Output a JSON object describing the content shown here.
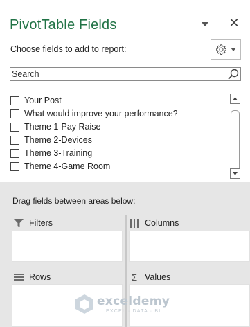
{
  "header": {
    "title": "PivotTable Fields",
    "subtitle": "Choose fields to add to report:"
  },
  "search": {
    "placeholder": "Search"
  },
  "fields": [
    {
      "label": "Your Post",
      "checked": false
    },
    {
      "label": "What would improve your performance?",
      "checked": false
    },
    {
      "label": "Theme 1-Pay Raise",
      "checked": false
    },
    {
      "label": "Theme 2-Devices",
      "checked": false
    },
    {
      "label": "Theme 3-Training",
      "checked": false
    },
    {
      "label": "Theme 4-Game Room",
      "checked": false
    }
  ],
  "areas": {
    "instruction": "Drag fields between areas below:",
    "filters": "Filters",
    "columns": "Columns",
    "rows": "Rows",
    "values": "Values"
  },
  "watermark": {
    "name": "exceldemy",
    "tagline": "EXCEL · DATA · BI"
  },
  "icons": {
    "close": "close-icon",
    "gear": "gear-icon",
    "search": "search-icon",
    "filter": "filter-icon",
    "columns": "columns-icon",
    "rows": "rows-icon",
    "sigma": "sigma-icon"
  },
  "colors": {
    "title": "#217346",
    "panel": "#ffffff",
    "background": "#e6e6e6"
  }
}
